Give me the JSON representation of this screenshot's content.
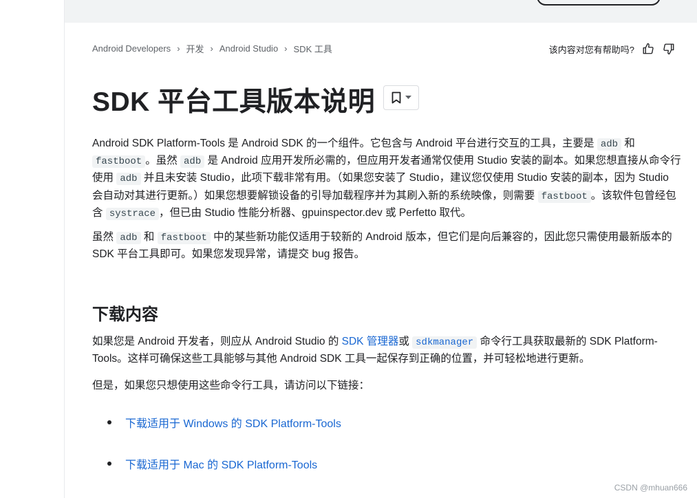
{
  "breadcrumb": [
    "Android Developers",
    "开发",
    "Android Studio",
    "SDK 工具"
  ],
  "feedback": {
    "question": "该内容对您有帮助吗?",
    "up_icon": "thumb-up-icon",
    "down_icon": "thumb-down-icon"
  },
  "title": "SDK 平台工具版本说明",
  "bookmark_icon": "bookmark-icon",
  "intro": {
    "t1": "Android SDK Platform-Tools 是 Android SDK 的一个组件。它包含与 Android 平台进行交互的工具，主要是 ",
    "c_adb": "adb",
    "t2": " 和 ",
    "c_fastboot": "fastboot",
    "t3": "。虽然 ",
    "t4": " 是 Android 应用开发所必需的，但应用开发者通常仅使用 Studio 安装的副本。如果您想直接从命令行使用 ",
    "t5": " 并且未安装 Studio，此项下载非常有用。（如果您安装了 Studio，建议您仅使用 Studio 安装的副本，因为 Studio 会自动对其进行更新。）如果您想要解锁设备的引导加载程序并为其刷入新的系统映像，则需要 ",
    "t6": "。该软件包曾经包含 ",
    "c_systrace": "systrace",
    "t7": "，但已由 Studio 性能分析器、gpuinspector.dev 或 Perfetto 取代。"
  },
  "compat": {
    "t1": "虽然 ",
    "t2": " 和 ",
    "t3": " 中的某些新功能仅适用于较新的 Android 版本，但它们是向后兼容的，因此您只需使用最新版本的 SDK 平台工具即可。如果您发现异常，请提交 bug 报告。"
  },
  "download": {
    "heading": "下载内容",
    "p1_t1": "如果您是 Android 开发者，则应从 Android Studio 的 ",
    "p1_link": "SDK 管理器",
    "p1_t2": "或 ",
    "p1_code": "sdkmanager",
    "p1_t3": " 命令行工具获取最新的 SDK Platform-Tools。这样可确保这些工具能够与其他 Android SDK 工具一起保存到正确的位置，并可轻松地进行更新。",
    "p2": "但是，如果您只想使用这些命令行工具，请访问以下链接：",
    "links": [
      "下载适用于 Windows 的 SDK Platform-Tools",
      "下载适用于 Mac 的 SDK Platform-Tools"
    ]
  },
  "watermark": "CSDN @mhuan666"
}
